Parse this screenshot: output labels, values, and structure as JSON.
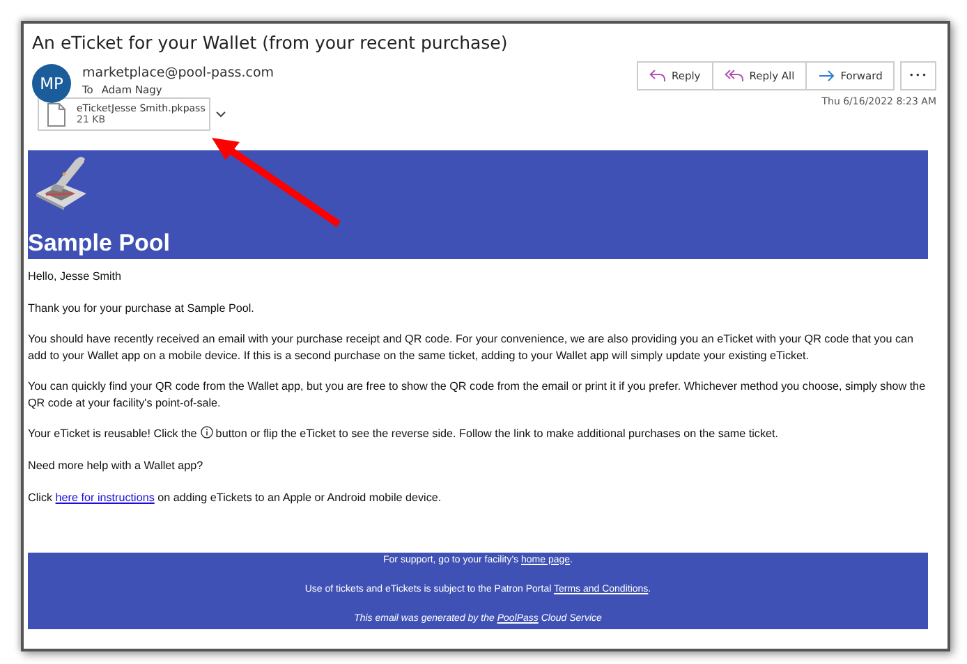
{
  "window": {
    "title": "An eTicket for your Wallet (from your recent purchase)"
  },
  "sender": {
    "initials": "MP",
    "address": "marketplace@pool-pass.com",
    "to_label": "To",
    "to": "Adam Nagy"
  },
  "actions": [
    {
      "kind": "reply",
      "label": "Reply"
    },
    {
      "kind": "reply_all",
      "label": "Reply All"
    },
    {
      "kind": "forward",
      "label": "Forward"
    },
    {
      "kind": "more",
      "label": "•••"
    }
  ],
  "date": "Thu 6/16/2022 8:23 AM",
  "attachment": {
    "name": "eTicketJesse Smith.pkpass",
    "size": "21 KB"
  },
  "banner": {
    "title": "Sample Pool"
  },
  "paragraphs": [
    [
      {
        "kind": "text",
        "text": "Hello, Jesse Smith"
      }
    ],
    [
      {
        "kind": "text",
        "text": "Thank you for your purchase at Sample Pool."
      }
    ],
    [
      {
        "kind": "text",
        "text": "You should have recently received an email with your purchase receipt and QR code. For your convenience, we are also providing you an eTicket with your QR code that you can add to your Wallet app on a mobile device. If this is a second purchase on the same ticket, adding to your Wallet app will simply update your existing eTicket."
      }
    ],
    [
      {
        "kind": "text",
        "text": "You can quickly find your QR code from the Wallet app, but you are free to show the QR code from the email or print it if you prefer. Whichever method you choose, simply show the QR code at your facility's point-of-sale."
      }
    ],
    [
      {
        "kind": "text",
        "text": "Your eTicket is reusable! Click the "
      },
      {
        "kind": "info_icon"
      },
      {
        "kind": "text",
        "text": " button or flip the eTicket to see the reverse side. Follow the link to make additional purchases on the same ticket."
      }
    ],
    [
      {
        "kind": "text",
        "text": "Need more help with a Wallet app?"
      }
    ],
    [
      {
        "kind": "text",
        "text": "Click "
      },
      {
        "kind": "link",
        "text": "here for instructions"
      },
      {
        "kind": "text",
        "text": " on adding eTickets to an Apple or Android mobile device."
      }
    ]
  ],
  "footer": [
    {
      "italic": false,
      "parts": [
        {
          "kind": "text",
          "text": "For support, go to your facility's "
        },
        {
          "kind": "link",
          "text": "home page"
        },
        {
          "kind": "text",
          "text": "."
        }
      ]
    },
    {
      "italic": false,
      "parts": [
        {
          "kind": "text",
          "text": "Use of tickets and eTickets is subject to the Patron Portal "
        },
        {
          "kind": "link",
          "text": "Terms and Conditions"
        },
        {
          "kind": "text",
          "text": "."
        }
      ]
    },
    {
      "italic": true,
      "parts": [
        {
          "kind": "text",
          "text": "This email was generated by the "
        },
        {
          "kind": "link",
          "text": "PoolPass"
        },
        {
          "kind": "text",
          "text": " Cloud Service"
        }
      ]
    }
  ],
  "annotation": {
    "kind": "arrow"
  }
}
